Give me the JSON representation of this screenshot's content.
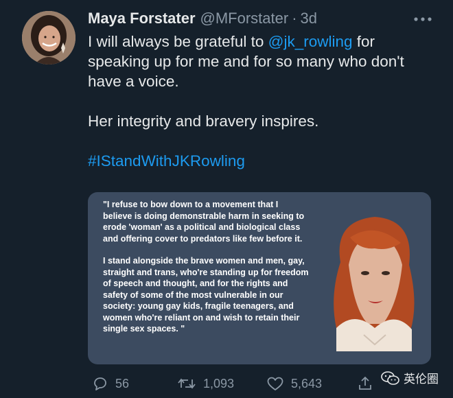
{
  "tweet": {
    "author_name": "Maya Forstater",
    "author_handle": "@MForstater",
    "separator": "·",
    "timestamp": "3d",
    "text_pre_mention": "I will always be grateful to ",
    "mention": "@jk_rowling",
    "text_post_mention": " for speaking up for me and for so many who don't have a voice.",
    "line2": "Her integrity and bravery inspires.",
    "hashtag": "#IStandWithJKRowling"
  },
  "quote_image": {
    "paragraph1": "\"I refuse to bow down to a movement that I believe is doing demonstrable harm in seeking to erode 'woman' as a political and biological class and offering cover to predators like few before it.",
    "paragraph2": "I stand alongside the brave women and men, gay, straight and trans, who're standing up for freedom of speech and thought, and for the rights and safety of some of the most vulnerable in our society: young gay kids, fragile teenagers, and women who're reliant on and wish to retain their single sex spaces. \""
  },
  "actions": {
    "replies": "56",
    "retweets": "1,093",
    "likes": "5,643"
  },
  "watermark": {
    "label": "英伦圈"
  },
  "colors": {
    "background": "#15202b",
    "link": "#1d9bf0",
    "muted": "#8b98a5",
    "card": "#3c4b60"
  }
}
